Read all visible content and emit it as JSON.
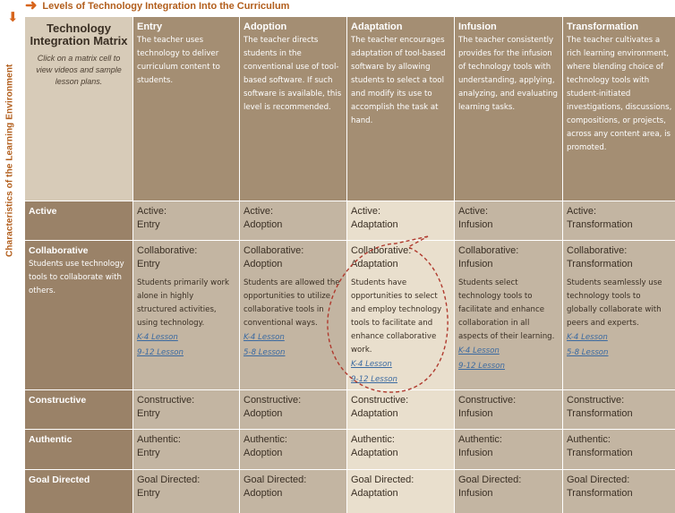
{
  "top_label": "Levels of Technology Integration Into the Curriculum",
  "side_label": "Characteristics of the Learning Environment",
  "matrix": {
    "title": "Technology Integration Matrix",
    "subtitle": "Click on a matrix cell to view videos and sample lesson plans."
  },
  "columns": [
    {
      "name": "Entry",
      "desc": "The teacher uses technology to deliver curriculum content to students."
    },
    {
      "name": "Adoption",
      "desc": "The teacher directs students in the conventional use of tool-based software. If such software is available, this level is recommended."
    },
    {
      "name": "Adaptation",
      "desc": "The teacher encourages adaptation of tool-based software by allowing students to select a tool and modify its use to accomplish the task at hand."
    },
    {
      "name": "Infusion",
      "desc": "The teacher consistently provides for the infusion of technology tools with understanding, applying, analyzing, and evaluating learning tasks."
    },
    {
      "name": "Transformation",
      "desc": "The teacher cultivates a rich learning environment, where blending choice of technology tools with student-initiated investigations, discussions, compositions, or projects, across any content area, is promoted."
    }
  ],
  "rows": {
    "active": {
      "name": "Active",
      "cells": [
        "Active:\nEntry",
        "Active:\nAdoption",
        "Active:\nAdaptation",
        "Active:\nInfusion",
        "Active:\nTransformation"
      ]
    },
    "collaborative": {
      "name": "Collaborative",
      "desc": "Students use technology tools to collaborate with others.",
      "cells": [
        {
          "title": "Collaborative:\nEntry",
          "text": "Students primarily work alone in highly structured activities, using technology.",
          "lessons": [
            "K-4 Lesson",
            "9-12 Lesson"
          ]
        },
        {
          "title": "Collaborative:\nAdoption",
          "text": "Students are allowed the opportunities to utilize collaborative tools in conventional ways.",
          "lessons": [
            "K-4 Lesson",
            "5-8 Lesson"
          ]
        },
        {
          "title": "Collaborative:\nAdaptation",
          "text": "Students have opportunities to select and employ technology tools to facilitate and enhance collaborative work.",
          "lessons": [
            "K-4 Lesson",
            "9-12 Lesson"
          ]
        },
        {
          "title": "Collaborative:\nInfusion",
          "text": "Students select technology tools to facilitate and enhance collaboration in all aspects of their learning.",
          "lessons": [
            "K-4 Lesson",
            "9-12 Lesson"
          ]
        },
        {
          "title": "Collaborative:\nTransformation",
          "text": "Students seamlessly use technology tools to globally collaborate with peers and experts.",
          "lessons": [
            "K-4 Lesson",
            "5-8 Lesson"
          ]
        }
      ]
    },
    "constructive": {
      "name": "Constructive",
      "cells": [
        "Constructive:\nEntry",
        "Constructive:\nAdoption",
        "Constructive:\nAdaptation",
        "Constructive:\nInfusion",
        "Constructive:\nTransformation"
      ]
    },
    "authentic": {
      "name": "Authentic",
      "cells": [
        "Authentic:\nEntry",
        "Authentic:\nAdoption",
        "Authentic:\nAdaptation",
        "Authentic:\nInfusion",
        "Authentic:\nTransformation"
      ]
    },
    "goal_directed": {
      "name": "Goal Directed",
      "cells": [
        "Goal Directed:\nEntry",
        "Goal Directed:\nAdoption",
        "Goal Directed:\nAdaptation",
        "Goal Directed:\nInfusion",
        "Goal Directed:\nTransformation"
      ]
    }
  },
  "colors": {
    "header_bg": "#a48e73",
    "row_header_bg": "#9a8268",
    "cell_bg": "#c3b5a2",
    "highlight_col_bg": "#e9dfcd",
    "accent_orange": "#d7651c",
    "highlight_outline": "#b03a2e",
    "link": "#3b6aa1"
  },
  "icons": {
    "top_arrow": "right-arrow-icon",
    "side_arrow": "down-arrow-icon"
  }
}
